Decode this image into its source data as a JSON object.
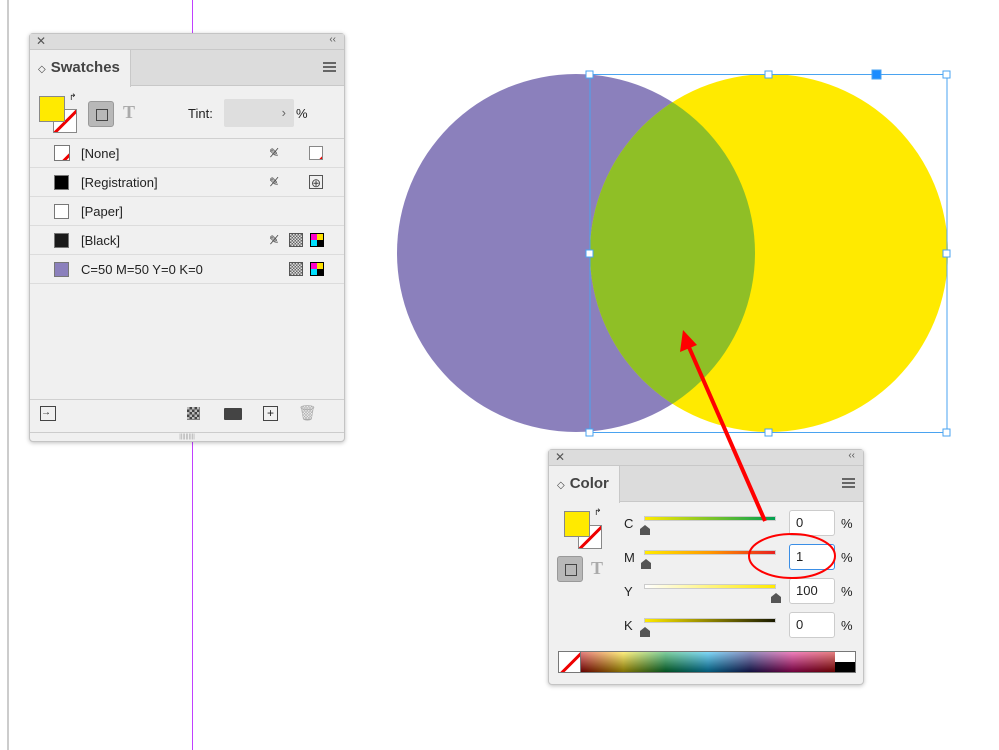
{
  "swatches": {
    "title": "Swatches",
    "tint_label": "Tint:",
    "tint_value": "",
    "tint_unit": "%",
    "items": [
      {
        "name": "[None]",
        "color": "none",
        "icons": [
          "no-edit-icon",
          "none-icon"
        ]
      },
      {
        "name": "[Registration]",
        "color": "#000000",
        "icons": [
          "no-edit-icon",
          "registration-icon"
        ]
      },
      {
        "name": "[Paper]",
        "color": "#ffffff",
        "icons": []
      },
      {
        "name": "[Black]",
        "color": "#1a1a1a",
        "icons": [
          "no-edit-icon",
          "process-icon",
          "cmyk-icon"
        ]
      },
      {
        "name": "C=50 M=50 Y=0 K=0",
        "color": "#8b80bc",
        "icons": [
          "process-icon",
          "cmyk-icon"
        ]
      }
    ],
    "footer_icons": [
      "load-swatches-icon",
      "show-swatch-kinds-icon",
      "new-group-icon",
      "new-swatch-icon",
      "delete-icon"
    ]
  },
  "color": {
    "title": "Color",
    "unit": "%",
    "channels": [
      {
        "label": "C",
        "value": "0"
      },
      {
        "label": "M",
        "value": "1"
      },
      {
        "label": "Y",
        "value": "100"
      },
      {
        "label": "K",
        "value": "0"
      }
    ]
  },
  "colors": {
    "purple": "#8b80bc",
    "yellow": "#ffea00",
    "overlap": "#8fbf26",
    "fill": "#ffea00",
    "annotation": "#ff0000",
    "selection": "#4aa3f0"
  }
}
